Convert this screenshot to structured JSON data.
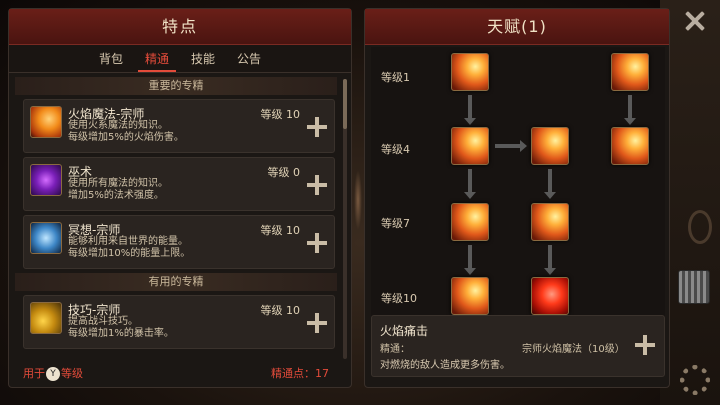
{
  "left_panel": {
    "title": "特点",
    "tabs": [
      {
        "label": "背包",
        "active": false
      },
      {
        "label": "精通",
        "active": true
      },
      {
        "label": "技能",
        "active": false
      },
      {
        "label": "公告",
        "active": false
      }
    ],
    "sections": [
      {
        "header": "重要的专精"
      },
      {
        "header": "有用的专精"
      }
    ],
    "masteries": [
      {
        "name": "火焰魔法-宗师",
        "level": "等级 10",
        "desc1": "使用火系魔法的知识。",
        "desc2": "每级增加5%的火焰伤害。",
        "icon": "fire-magic-icon"
      },
      {
        "name": "巫术",
        "level": "等级 0",
        "desc1": "使用所有魔法的知识。",
        "desc2": "增加5%的法术强度。",
        "icon": "witchcraft-icon"
      },
      {
        "name": "冥想-宗师",
        "level": "等级 10",
        "desc1": "能够利用来自世界的能量。",
        "desc2": "每级增加10%的能量上限。",
        "icon": "meditation-icon"
      },
      {
        "name": "技巧-宗师",
        "level": "等级 10",
        "desc1": "提高战斗技巧。",
        "desc2": "每级增加1%的暴击率。",
        "icon": "skill-icon"
      }
    ],
    "footer": {
      "left_prefix": "用于",
      "button": "Y",
      "left_suffix": "等级",
      "points": "精通点：17"
    }
  },
  "right_panel": {
    "title": "天赋(1)",
    "levels": [
      "等级1",
      "等级4",
      "等级7",
      "等级10"
    ],
    "detail": {
      "title": "火焰痛击",
      "req_label": "精通：",
      "req_value": "宗师火焰魔法（10级）",
      "desc": "对燃烧的敌人造成更多伤害。"
    }
  },
  "colors": {
    "header_red": "#6a1f18",
    "accent_red": "#e34b3a",
    "panel_bg": "#1b1714"
  }
}
